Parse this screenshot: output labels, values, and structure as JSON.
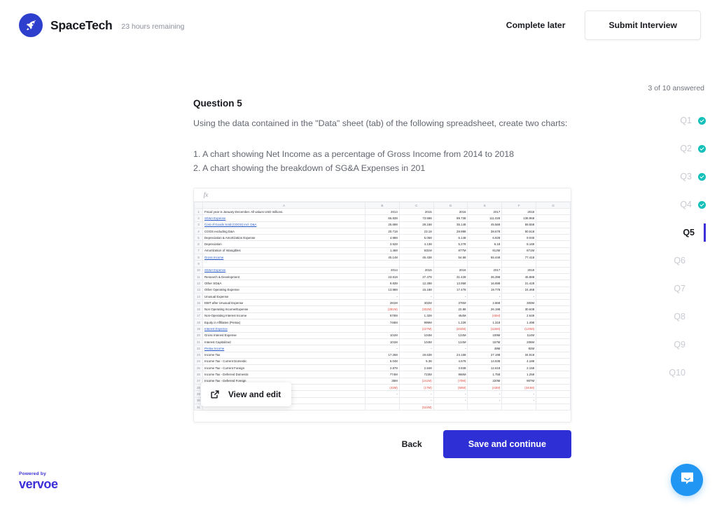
{
  "header": {
    "brand_name": "SpaceTech",
    "time_remaining": "23 hours remaining",
    "complete_later_label": "Complete later",
    "submit_label": "Submit Interview",
    "logo_icon": "rocket-icon"
  },
  "qnav": {
    "progress_text": "3 of 10 answered",
    "items": [
      {
        "label": "Q1",
        "answered": true,
        "current": false
      },
      {
        "label": "Q2",
        "answered": true,
        "current": false
      },
      {
        "label": "Q3",
        "answered": true,
        "current": false
      },
      {
        "label": "Q4",
        "answered": true,
        "current": false
      },
      {
        "label": "Q5",
        "answered": false,
        "current": true
      },
      {
        "label": "Q6",
        "answered": false,
        "current": false
      },
      {
        "label": "Q7",
        "answered": false,
        "current": false
      },
      {
        "label": "Q8",
        "answered": false,
        "current": false
      },
      {
        "label": "Q9",
        "answered": false,
        "current": false
      },
      {
        "label": "Q10",
        "answered": false,
        "current": false
      }
    ]
  },
  "question": {
    "title": "Question 5",
    "description": "Using the data contained in the \"Data\" sheet (tab) of the following spreadsheet, create two charts:",
    "item1": "1. A chart showing Net Income as a percentage of Gross Income from 2014 to 2018",
    "item2": "2. A chart showing the breakdown of SG&A Expenses in 201"
  },
  "spreadsheet": {
    "fx_label": "fx",
    "view_edit_label": "View and edit",
    "view_edit_icon": "external-link-icon",
    "columns": [
      "A",
      "B",
      "C",
      "D",
      "E",
      "F",
      "G"
    ],
    "rows": [
      {
        "n": 1,
        "label": "Fiscal year is January-December. All values USD millions.",
        "style": "plain",
        "cells": [
          "2014",
          "2015",
          "2016",
          "2017",
          "2018",
          ""
        ],
        "cellstyle": "year"
      },
      {
        "n": 2,
        "label": "SG&A Expense",
        "style": "link",
        "cells": [
          "65.838",
          "73.598",
          "89.738",
          "111.028",
          "136.968",
          ""
        ]
      },
      {
        "n": 3,
        "label": "Cost of Goods Sold (COGS) incl. D&A",
        "style": "link",
        "cells": [
          "25.698",
          "28.168",
          "35.148",
          "45.568",
          "59.558",
          ""
        ]
      },
      {
        "n": 4,
        "label": "COGS excluding D&A",
        "style": "plain",
        "cells": [
          "20.718",
          "23.18",
          "28.998",
          "38.678",
          "50.518",
          ""
        ]
      },
      {
        "n": 5,
        "label": "Depreciation & Amortization Expense",
        "style": "plain",
        "cells": [
          "4.988",
          "5.068",
          "6.148",
          "6.928",
          "9.048",
          ""
        ]
      },
      {
        "n": 6,
        "label": "Depreciation",
        "style": "plain",
        "cells": [
          "3.528",
          "4.138",
          "5.278",
          "6.18",
          "8.168",
          ""
        ]
      },
      {
        "n": 7,
        "label": "Amortization of Intangibles",
        "style": "plain",
        "cells": [
          "1.468",
          "931M",
          "877M",
          "812M",
          "871M",
          ""
        ]
      },
      {
        "n": 8,
        "label": "Gross Income",
        "style": "link",
        "cells": [
          "40.148",
          "45.438",
          "54.68",
          "65.448",
          "77.418",
          ""
        ]
      },
      {
        "n": 9,
        "label": "",
        "style": "plain",
        "cells": [
          "",
          "",
          "",
          "",
          "",
          ""
        ]
      },
      {
        "n": 10,
        "label": "SG&A Expense",
        "style": "link",
        "cells": [
          "2014",
          "2015",
          "2016",
          "2017",
          "2018",
          ""
        ],
        "cellstyle": "year"
      },
      {
        "n": 11,
        "label": "Research & Development",
        "style": "plain",
        "cells": [
          "23.818",
          "27.478",
          "31.428",
          "36.398",
          "45.888",
          ""
        ]
      },
      {
        "n": 12,
        "label": "Other SG&A",
        "style": "plain",
        "cells": [
          "9.838",
          "12.288",
          "13.958",
          "16.698",
          "21.428",
          ""
        ]
      },
      {
        "n": 13,
        "label": "Other Operating Expense",
        "style": "plain",
        "cells": [
          "13.988",
          "15.188",
          "17.478",
          "19.778",
          "24.468",
          ""
        ]
      },
      {
        "n": 14,
        "label": "Unusual Expense",
        "style": "plain",
        "cells": [
          "-",
          "-",
          "-",
          "-",
          "-",
          ""
        ]
      },
      {
        "n": 15,
        "label": "EBIT after Unusual Expense",
        "style": "plain",
        "cells": [
          "281M",
          "302M",
          "375M",
          "2.868",
          "300M",
          ""
        ]
      },
      {
        "n": 16,
        "label": "Non Operating Income/Expense",
        "style": "plain",
        "cells": [
          "(281M)",
          "(302M)",
          "22.88",
          "26.198",
          "30.638",
          ""
        ],
        "negs": [
          0,
          1
        ]
      },
      {
        "n": 17,
        "label": "Non-Operating Interest Income",
        "style": "plain",
        "cells": [
          "570M",
          "1.328",
          "454M",
          "(45M)",
          "2.648",
          ""
        ],
        "negs": [
          3
        ]
      },
      {
        "n": 18,
        "label": "Equity in Affiliates (Pretax)",
        "style": "plain",
        "cells": [
          "746M",
          "999M",
          "1.228",
          "1.318",
          "1.498",
          ""
        ]
      },
      {
        "n": 19,
        "label": "Interest Expense",
        "style": "link",
        "cells": [
          "",
          "(227M)",
          "(202M)",
          "(116M)",
          "(120M)",
          ""
        ],
        "negs": [
          1,
          2,
          3,
          4
        ]
      },
      {
        "n": 20,
        "label": "Gross Interest Expense",
        "style": "plain",
        "cells": [
          "101M",
          "104M",
          "124M",
          "109M",
          "114M",
          ""
        ]
      },
      {
        "n": 21,
        "label": "Interest Capitalized",
        "style": "plain",
        "cells": [
          "101M",
          "104M",
          "124M",
          "157M",
          "206M",
          ""
        ]
      },
      {
        "n": 22,
        "label": "Pretax Income",
        "style": "link",
        "cells": [
          "-",
          "-",
          "-",
          "48M",
          "92M",
          ""
        ]
      },
      {
        "n": 23,
        "label": "Income Tax",
        "style": "plain",
        "cells": [
          "17.268",
          "19.638",
          "24.158",
          "27.198",
          "34.918",
          ""
        ]
      },
      {
        "n": 24,
        "label": "Income Tax - Current Domestic",
        "style": "plain",
        "cells": [
          "5.048",
          "5.38",
          "4.678",
          "14.538",
          "4.188",
          ""
        ]
      },
      {
        "n": 25,
        "label": "Income Tax - Current Foreign",
        "style": "plain",
        "cells": [
          "2.878",
          "2.848",
          "3.838",
          "12.618",
          "2.158",
          ""
        ]
      },
      {
        "n": 26,
        "label": "Income Tax - Deferred Domestic",
        "style": "plain",
        "cells": [
          "774M",
          "723M",
          "966M",
          "1.758",
          "1.258",
          ""
        ]
      },
      {
        "n": 27,
        "label": "Income Tax - Deferred Foreign",
        "style": "plain",
        "cells": [
          "35M",
          "(241M)",
          "(70M)",
          "220M",
          "907M",
          ""
        ],
        "negs": [
          1,
          2
        ]
      },
      {
        "n": 28,
        "label": "",
        "style": "plain",
        "cells": [
          "(43M)",
          "(17M)",
          "(50M)",
          "(43M)",
          "(344M)",
          ""
        ],
        "negs": [
          0,
          1,
          2,
          3,
          4
        ]
      },
      {
        "n": 29,
        "label": "",
        "style": "plain",
        "cells": [
          "-",
          "-",
          "-",
          "-",
          "-",
          ""
        ]
      },
      {
        "n": 30,
        "label": "",
        "style": "plain",
        "cells": [
          "",
          "-",
          "-",
          "-",
          "-",
          ""
        ]
      },
      {
        "n": 31,
        "label": "",
        "style": "plain",
        "cells": [
          "",
          "(522M)",
          "",
          "",
          "",
          ""
        ],
        "negs": [
          1
        ]
      }
    ]
  },
  "actions": {
    "back_label": "Back",
    "save_label": "Save and continue"
  },
  "footer": {
    "powered_by": "Powered by",
    "vendor": "vervoe"
  },
  "chat": {
    "icon": "chat-bubble-icon"
  },
  "colors": {
    "brand_blue": "#3b2fd8",
    "primary_button": "#2f2fd6",
    "check_teal": "#13c0ba",
    "chat_blue": "#2196f3",
    "negative_red": "#e04a3f",
    "cell_link": "#2558c8"
  }
}
